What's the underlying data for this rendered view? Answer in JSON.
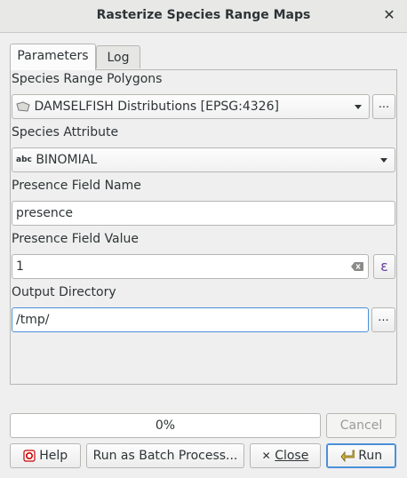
{
  "window": {
    "title": "Rasterize Species Range Maps"
  },
  "tabs": [
    {
      "label": "Parameters",
      "active": true
    },
    {
      "label": "Log",
      "active": false
    }
  ],
  "params": {
    "species_range_polygons": {
      "label": "Species Range Polygons",
      "value": "DAMSELFISH Distributions [EPSG:4326]",
      "browse_label": "..."
    },
    "species_attribute": {
      "label": "Species Attribute",
      "type_badge": "abc",
      "value": "BINOMIAL"
    },
    "presence_field_name": {
      "label": "Presence Field Name",
      "value": "presence"
    },
    "presence_field_value": {
      "label": "Presence Field Value",
      "value": "1",
      "expression_label": "ε"
    },
    "output_directory": {
      "label": "Output Directory",
      "value": "/tmp/",
      "browse_label": "..."
    }
  },
  "progress": {
    "text": "0%",
    "fraction": 0
  },
  "buttons": {
    "cancel": "Cancel",
    "help": "Help",
    "batch": "Run as Batch Process...",
    "close": "Close",
    "run": "Run"
  },
  "colors": {
    "accent": "#4a90d9",
    "help_icon": "#cc0000"
  }
}
